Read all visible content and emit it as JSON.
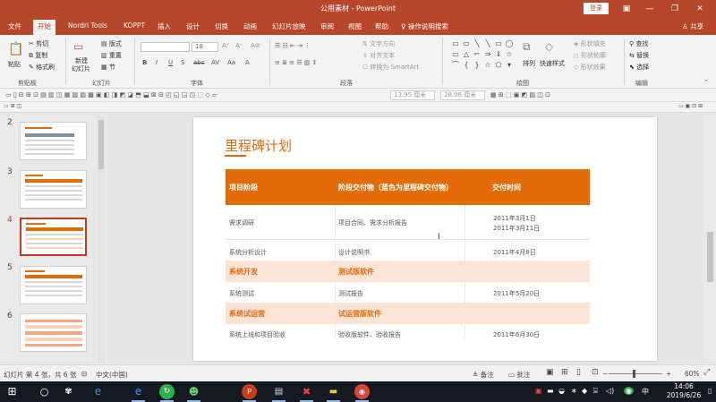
{
  "window": {
    "title": "公用素材  -  PowerPoint",
    "login_button": "登录"
  },
  "ribbon_tabs": [
    "文件",
    "开始",
    "Nordri Tools",
    "KOPPT",
    "插入",
    "设计",
    "切换",
    "动画",
    "幻灯片放映",
    "审阅",
    "视图",
    "帮助"
  ],
  "active_tab": "开始",
  "tell_me": "操作说明搜索",
  "share": "共享",
  "clipboard": {
    "paste": "粘贴",
    "cut": "剪切",
    "copy": "复制",
    "format_painter": "格式刷",
    "label": "剪贴板"
  },
  "slides_group": {
    "new_slide": "新建",
    "new_slide_2": "幻灯片",
    "layout": "版式",
    "reset": "重置",
    "section": "节",
    "label": "幻灯片"
  },
  "font_group": {
    "font_size": "18",
    "label": "字体"
  },
  "paragraph_group": {
    "text_direction": "文字方向",
    "align_text": "对齐文本",
    "smartart": "转换为 SmartArt",
    "label": "段落"
  },
  "drawing_group": {
    "arrange": "排列",
    "quick_styles": "快速样式",
    "fill": "形状填充",
    "outline": "形状轮廓",
    "effects": "形状效果",
    "label": "绘图"
  },
  "editing_group": {
    "find": "查找",
    "replace": "替换",
    "select": "选择",
    "label": "编辑"
  },
  "quick_access": {
    "height": "13.95 厘米",
    "width": "28.06 厘米"
  },
  "thumbnails": [
    {
      "number": "2"
    },
    {
      "number": "3"
    },
    {
      "number": "4",
      "selected": true
    },
    {
      "number": "5"
    },
    {
      "number": "6"
    }
  ],
  "slide": {
    "title": "里程碑计划",
    "header": [
      "项目阶段",
      "阶段交付物（蓝色为里程碑交付物）",
      "交付时间"
    ],
    "rows": [
      {
        "phase": "需求调研",
        "deliverable": "项目合同、需求分析报告",
        "date": "2011年3月1日",
        "date2": "2011年3月11日"
      },
      {
        "phase": "系统分析设计",
        "deliverable": "设计说明书",
        "date": "2011年4月8日"
      },
      {
        "phase": "系统开发",
        "deliverable": "测试版软件",
        "milestone": true
      },
      {
        "phase": "系统测试",
        "deliverable": "测试报告",
        "date": "2011年5月20日"
      },
      {
        "phase": "系统试运营",
        "deliverable": "试运营版软件",
        "milestone": true
      },
      {
        "phase": "系统上线和项目验收",
        "deliverable": "验收版软件、验收报告",
        "date": "2011年6月30日"
      }
    ]
  },
  "status_bar": {
    "slide_info": "幻灯片 第 4 张，共 6 张",
    "language": "中文(中国)",
    "notes": "备注",
    "comments": "批注",
    "zoom": "60%"
  },
  "clock": {
    "time": "14:06",
    "date": "2019/6/26"
  },
  "colors": {
    "brand": "#b7472a",
    "accent": "#e36c09",
    "milestone_fill": "#fbe3d6"
  }
}
